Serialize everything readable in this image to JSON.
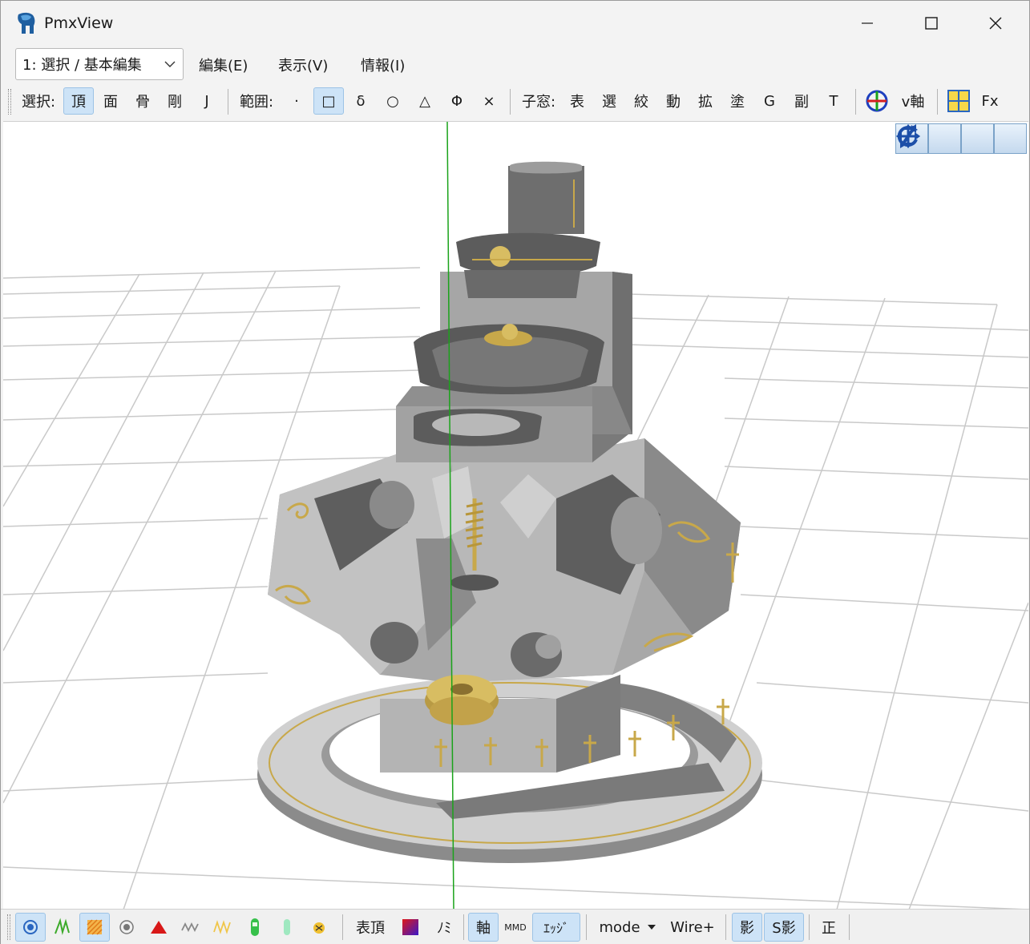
{
  "window": {
    "title": "PmxView"
  },
  "menu": {
    "mode_select_value": "1: 選択 / 基本編集",
    "items": [
      "編集(E)",
      "表示(V)",
      "情報(I)"
    ]
  },
  "toolbar": {
    "select_label": "選択:",
    "select_items": [
      "頂",
      "面",
      "骨",
      "剛",
      "J"
    ],
    "range_label": "範囲:",
    "range_items": [
      "·",
      "□",
      "δ",
      "○",
      "△",
      "Φ",
      "×"
    ],
    "child_label": "子窓:",
    "child_items": [
      "表",
      "選",
      "絞",
      "動",
      "拡",
      "塗",
      "G",
      "副",
      "T"
    ],
    "axis_label": "v軸",
    "fx_label": "Fx"
  },
  "statusbar": {
    "vertex_label": "表頂",
    "mi_label": "ﾉﾐ",
    "axis_label": "軸",
    "mmd_label": "MMD",
    "edge_label": "ｴｯｼﾞ",
    "mode_label": "mode",
    "wire_label": "Wire+",
    "shadow_label": "影",
    "sshadow_label": "S影",
    "ortho_label": "正"
  },
  "colors": {
    "accent_selected": "#cde3f7",
    "axis_green": "#1aa31a",
    "gold": "#c8a84a",
    "model_gray": "#8f8f8f"
  }
}
